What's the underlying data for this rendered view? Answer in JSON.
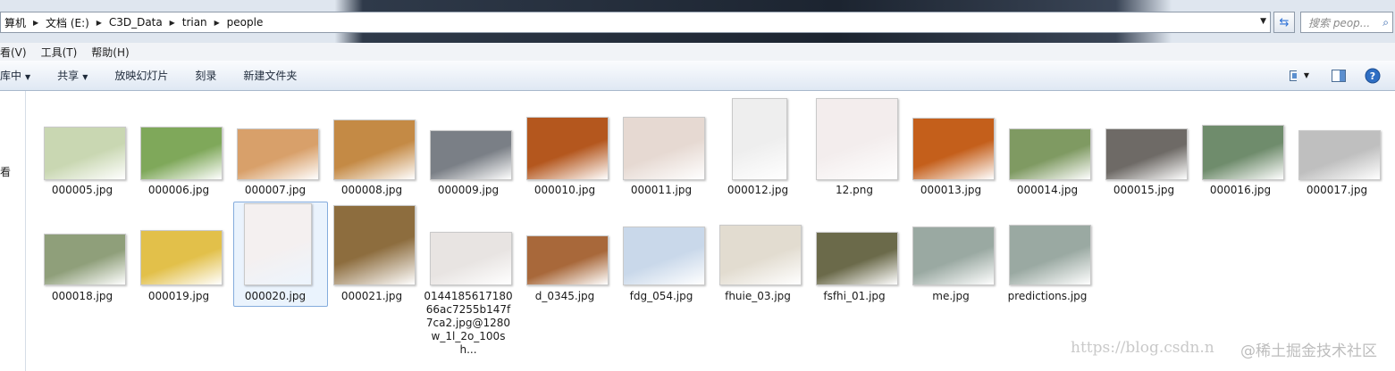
{
  "address_bar": {
    "crumbs": [
      "算机",
      "文档 (E:)",
      "C3D_Data",
      "trian",
      "people"
    ]
  },
  "search": {
    "placeholder": "搜索 peop..."
  },
  "menu": [
    "看(V)",
    "工具(T)",
    "帮助(H)"
  ],
  "commands": {
    "organize": "库中",
    "share": "共享",
    "slideshow": "放映幻灯片",
    "burn": "刻录",
    "new_folder": "新建文件夹"
  },
  "nav": {
    "partial_label": "看"
  },
  "files": [
    {
      "name": "000005.jpg",
      "color": "#c9d7b2",
      "icon": "photo-woman-icon"
    },
    {
      "name": "000006.jpg",
      "color": "#7fa85a",
      "icon": "photo-tiger-icon"
    },
    {
      "name": "000007.jpg",
      "color": "#d8a06a",
      "icon": "photo-puppy-icon"
    },
    {
      "name": "000008.jpg",
      "color": "#c48a45",
      "icon": "photo-dogs-icon"
    },
    {
      "name": "000009.jpg",
      "color": "#7a7f86",
      "icon": "photo-animal-icon"
    },
    {
      "name": "000010.jpg",
      "color": "#b4571e",
      "icon": "photo-retina-icon"
    },
    {
      "name": "000011.jpg",
      "color": "#e6d9d2",
      "icon": "photo-woman-icon"
    },
    {
      "name": "000012.jpg",
      "color": "#eeeeee",
      "icon": "photo-person-icon"
    },
    {
      "name": "12.png",
      "color": "#f3eded",
      "icon": "photo-seal-icon"
    },
    {
      "name": "000013.jpg",
      "color": "#c45f1b",
      "icon": "photo-retina-icon"
    },
    {
      "name": "000014.jpg",
      "color": "#7f9a62",
      "icon": "photo-horse-icon"
    },
    {
      "name": "000015.jpg",
      "color": "#6e6a66",
      "icon": "photo-wolf-icon"
    },
    {
      "name": "000016.jpg",
      "color": "#6f8c6c",
      "icon": "photo-dragonfly-icon"
    },
    {
      "name": "000017.jpg",
      "color": "#bfbfbf",
      "icon": "photo-leopard-icon"
    },
    {
      "name": "000018.jpg",
      "color": "#8f9f7a",
      "icon": "photo-dogs-icon"
    },
    {
      "name": "000019.jpg",
      "color": "#e2c04a",
      "icon": "photo-bird-icon"
    },
    {
      "name": "000020.jpg",
      "color": "#f4f0f0",
      "icon": "photo-seal-grid-icon"
    },
    {
      "name": "000021.jpg",
      "color": "#8d6d3e",
      "icon": "photo-leopard-icon"
    },
    {
      "name": "014418561718066ac7255b147f7ca2.jpg@1280w_1l_2o_100sh...",
      "color": "#e8e4e2",
      "icon": "photo-woman-icon"
    },
    {
      "name": "d_0345.jpg",
      "color": "#a8683a",
      "icon": "photo-elephants-icon"
    },
    {
      "name": "fdg_054.jpg",
      "color": "#c9d8ea",
      "icon": "photo-fox-icon"
    },
    {
      "name": "fhuie_03.jpg",
      "color": "#e2dcd0",
      "icon": "photo-puppy-icon"
    },
    {
      "name": "fsfhi_01.jpg",
      "color": "#6b6a4a",
      "icon": "photo-bear-icon"
    },
    {
      "name": "me.jpg",
      "color": "#9aa9a2",
      "icon": "photo-person-icon"
    },
    {
      "name": "predictions.jpg",
      "color": "#9aa9a2",
      "icon": "photo-person-icon"
    }
  ],
  "watermark": {
    "url": "https://blog.csdn.n",
    "text": "@稀土掘金技术社区"
  }
}
